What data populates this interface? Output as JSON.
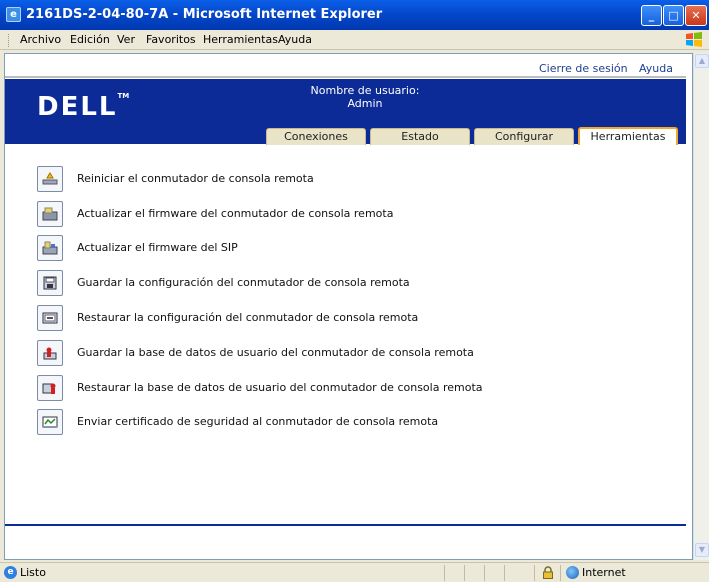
{
  "window": {
    "title": "2161DS-2-04-80-7A - Microsoft Internet Explorer",
    "app_icon": "ie-page-icon"
  },
  "menu": {
    "items": [
      {
        "label": "Archivo"
      },
      {
        "label": "Edición"
      },
      {
        "label": "Ver"
      },
      {
        "label": "Favoritos"
      },
      {
        "label": "Herramientas"
      },
      {
        "label": "Ayuda"
      }
    ]
  },
  "header": {
    "logout": "Cierre de sesión",
    "help": "Ayuda",
    "brand": "DELL",
    "trademark": "TM",
    "username_label": "Nombre de usuario:",
    "username_value": "Admin"
  },
  "tabs": [
    {
      "label": "Conexiones",
      "active": false
    },
    {
      "label": "Estado",
      "active": false
    },
    {
      "label": "Configurar",
      "active": false
    },
    {
      "label": "Herramientas",
      "active": true
    }
  ],
  "tools": [
    {
      "label": "Reiniciar el conmutador de consola remota",
      "icon": "reboot-icon"
    },
    {
      "label": "Actualizar el firmware del conmutador de consola remota",
      "icon": "firmware-upgrade-icon"
    },
    {
      "label": "Actualizar el firmware del SIP",
      "icon": "sip-firmware-icon"
    },
    {
      "label": "Guardar la configuración del conmutador de consola remota",
      "icon": "save-config-icon"
    },
    {
      "label": "Restaurar la configuración del conmutador de consola remota",
      "icon": "restore-config-icon"
    },
    {
      "label": "Guardar la base de datos de usuario del conmutador de consola remota",
      "icon": "save-userdb-icon"
    },
    {
      "label": "Restaurar la base de datos de usuario del conmutador de consola remota",
      "icon": "restore-userdb-icon"
    },
    {
      "label": "Enviar certificado de seguridad al conmutador de consola remota",
      "icon": "certificate-icon"
    }
  ],
  "status": {
    "text": "Listo",
    "zone": "Internet"
  },
  "colors": {
    "dell_blue": "#0c2b96",
    "active_tab_border": "#f0a830",
    "link": "#1f3f8f"
  }
}
